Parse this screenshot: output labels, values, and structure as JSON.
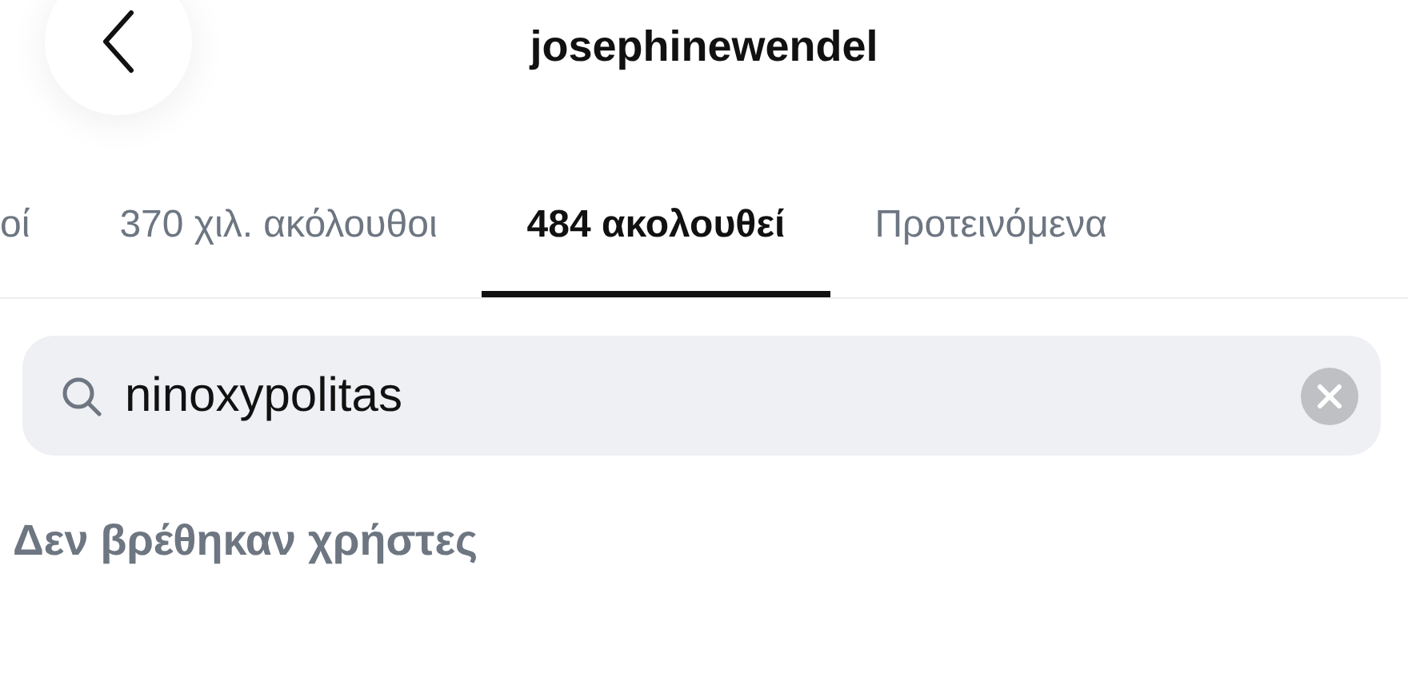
{
  "header": {
    "title": "josephinewendel"
  },
  "tabs": [
    {
      "label": "οί",
      "selected": false
    },
    {
      "label": "370 χιλ. ακόλουθοι",
      "selected": false
    },
    {
      "label": "484 ακολουθεί",
      "selected": true
    },
    {
      "label": "Προτεινόμενα",
      "selected": false
    }
  ],
  "search": {
    "value": "ninoxypolitas"
  },
  "empty_message": "Δεν βρέθηκαν χρήστες"
}
